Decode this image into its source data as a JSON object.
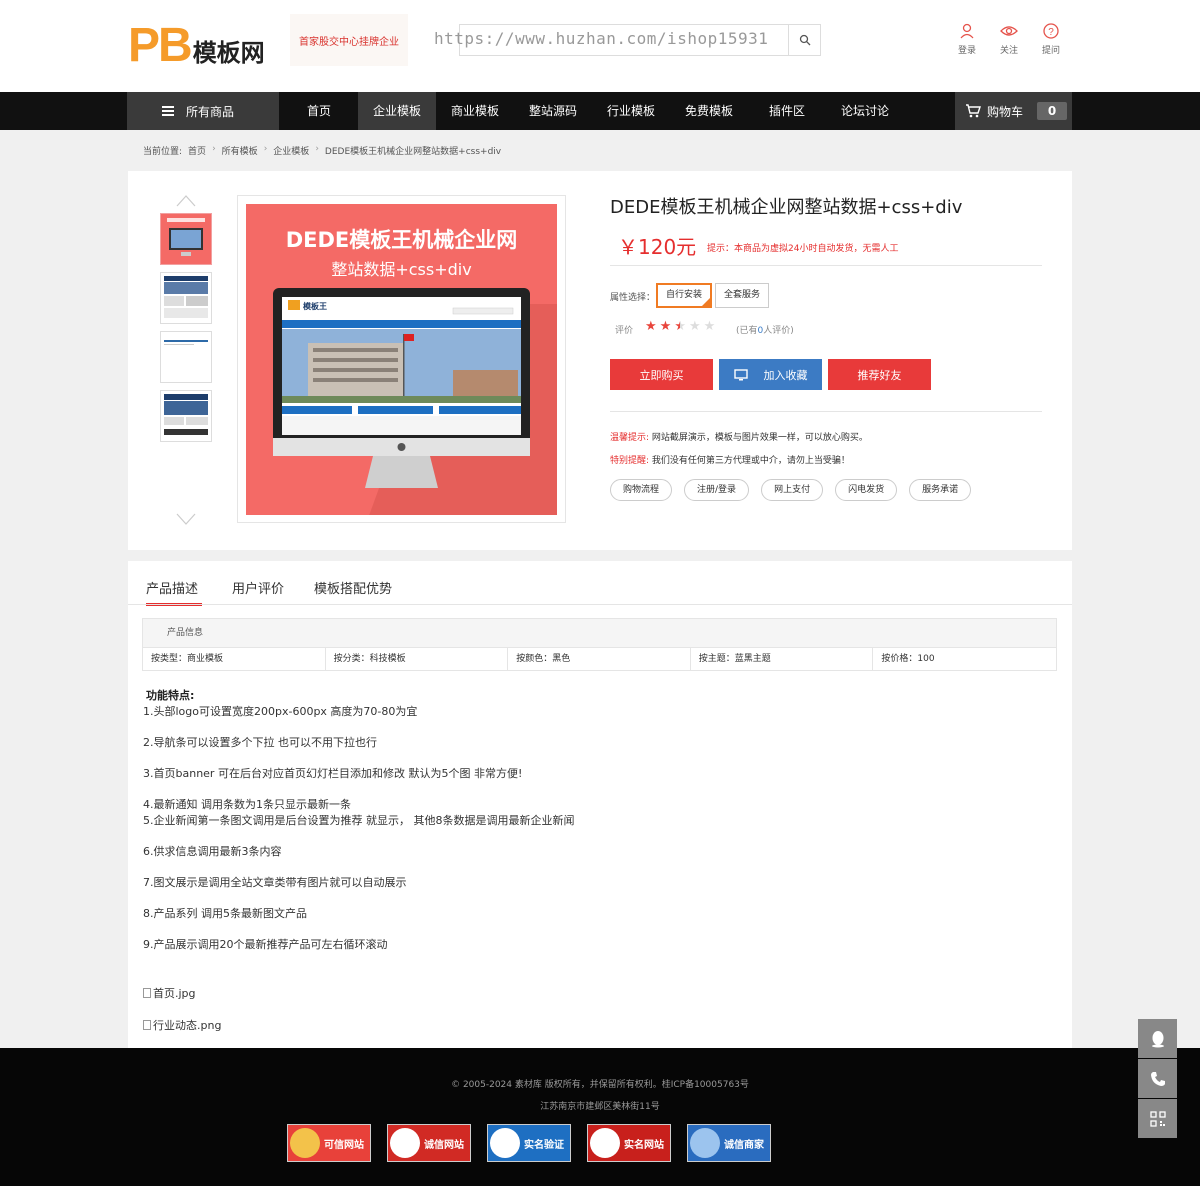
{
  "header": {
    "logo_pb": "PB",
    "logo_name": "模板网",
    "promo_text": "首家股交中心挂牌企业",
    "search_watermark": "https://www.huzhan.com/ishop15931",
    "links": [
      {
        "label": "登录",
        "icon": "user-icon"
      },
      {
        "label": "关注",
        "icon": "eye-icon"
      },
      {
        "label": "提问",
        "icon": "question-icon"
      }
    ]
  },
  "nav": {
    "all_categories": "所有商品",
    "items": [
      "首页",
      "企业模板",
      "商业模板",
      "整站源码",
      "行业模板",
      "免费模板",
      "插件区",
      "论坛讨论"
    ],
    "active_index": 1,
    "cart_label": "购物车",
    "cart_count": "0"
  },
  "breadcrumb": {
    "prefix": "当前位置:",
    "items": [
      "首页",
      "所有模板",
      "企业模板",
      "DEDE模板王机械企业网整站数据+css+div"
    ]
  },
  "product": {
    "image_title": "DEDE模板王机械企业网",
    "image_subtitle": "整站数据+css+div",
    "title": "DEDE模板王机械企业网整站数据+css+div",
    "price": "￥120元",
    "price_note": "提示：本商品为虚拟24小时自动发货，无需人工",
    "attr_label": "属性选择：",
    "options": [
      "自行安装",
      "全套服务"
    ],
    "selected_option": 0,
    "rating_label": "评价",
    "rating": 2.5,
    "review_prefix": "(已有",
    "review_count": "0",
    "review_suffix": "人评价)",
    "buttons": {
      "buy": "立即购买",
      "favorite": "加入收藏",
      "recommend": "推荐好友"
    },
    "tip1_key": "温馨提示:",
    "tip1_text": "网站截屏演示，模板与图片效果一样，可以放心购买。",
    "tip2_key": "特别提醒:",
    "tip2_text": "我们没有任何第三方代理或中介，请勿上当受骗！",
    "service_tags": [
      "购物流程",
      "注册/登录",
      "网上支付",
      "闪电发货",
      "服务承诺"
    ]
  },
  "tabs": [
    "产品描述",
    "用户评价",
    "模板搭配优势"
  ],
  "info_table": {
    "header": "产品信息",
    "cells": [
      "按类型：商业模板",
      "按分类：科技模板",
      "按颜色：黑色",
      "按主题：蓝黑主题",
      "按价格：100"
    ]
  },
  "features": {
    "title": "功能特点:",
    "items": [
      "1.头部logo可设置宽度200px-600px    高度为70-80为宜",
      "2.导航条可以设置多个下拉 也可以不用下拉也行",
      "3.首页banner 可在后台对应首页幻灯栏目添加和修改 默认为5个图  非常方便!",
      "4.最新通知 调用条数为1条只显示最新一条",
      "5.企业新闻第一条图文调用是后台设置为推荐 就显示， 其他8条数据是调用最新企业新闻",
      "6.供求信息调用最新3条内容",
      "7.图文展示是调用全站文章类带有图片就可以自动展示",
      "8.产品系列 调用5条最新图文产品",
      "9.产品展示调用20个最新推荐产品可左右循环滚动"
    ],
    "images": [
      "首页.jpg",
      "行业动态.png"
    ]
  },
  "footer": {
    "copyright": "© 2005-2024 素材库 版权所有，并保留所有权利。桂ICP备10005763号",
    "address": "江苏南京市建邺区美林街11号",
    "badges": [
      {
        "text": "可信网站",
        "color": "#e8413a"
      },
      {
        "text": "诚信网站",
        "color": "#d12a24"
      },
      {
        "text": "实名验证",
        "color": "#1e6fc2"
      },
      {
        "text": "实名网站",
        "color": "#c8201c"
      },
      {
        "text": "诚信商家",
        "color": "#2a6cbf"
      }
    ]
  },
  "side": [
    "qq-icon",
    "phone-icon",
    "qrcode-icon"
  ],
  "colors": {
    "accent_red": "#e83a3a",
    "favorite_blue": "#3c7bc4",
    "nav_bg": "#111111"
  }
}
